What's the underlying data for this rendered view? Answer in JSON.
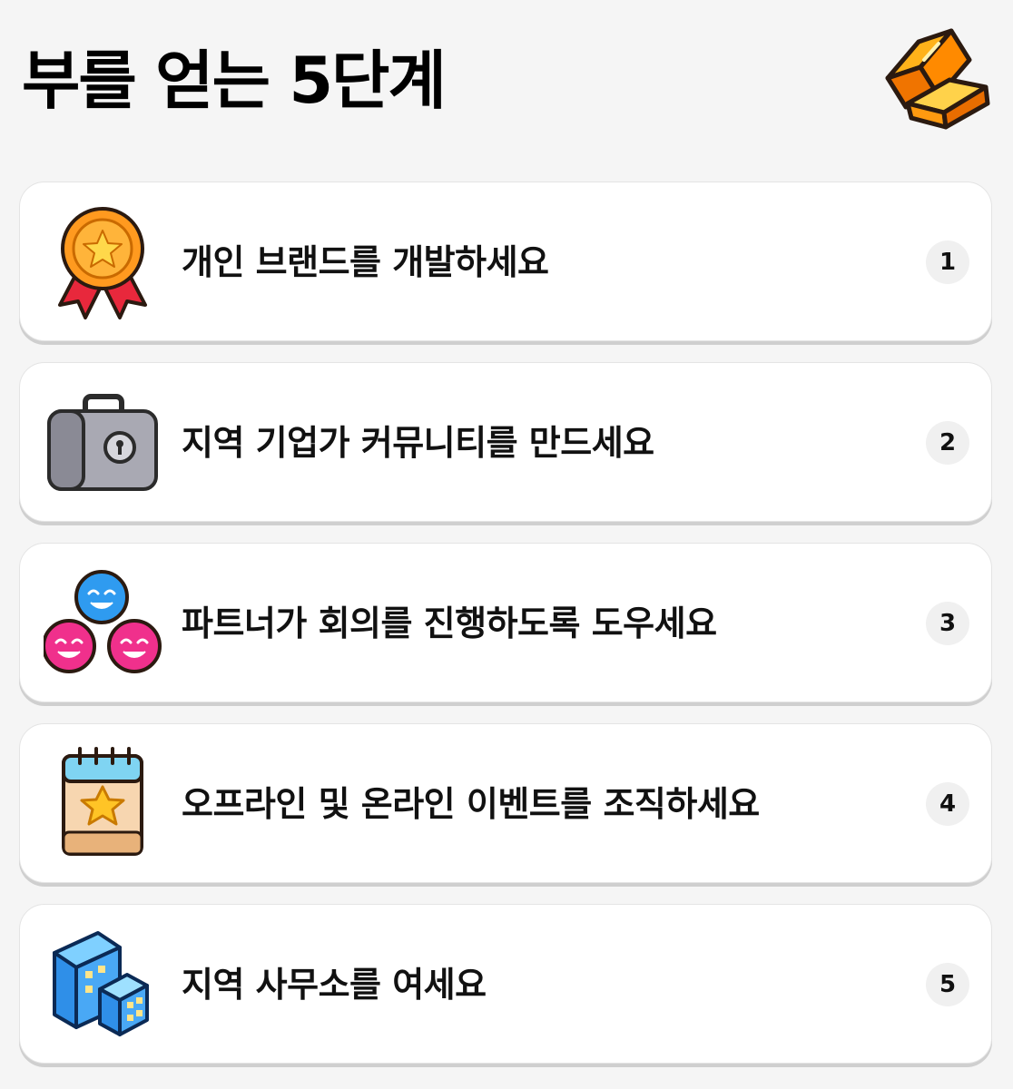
{
  "header": {
    "title": "부를 얻는 5단계",
    "icon": "gold-bars-icon"
  },
  "steps": [
    {
      "number": "1",
      "label": "개인 브랜드를 개발하세요",
      "icon": "medal-icon"
    },
    {
      "number": "2",
      "label": "지역 기업가 커뮤니티를 만드세요",
      "icon": "briefcase-icon"
    },
    {
      "number": "3",
      "label": "파트너가 회의를 진행하도록 도우세요",
      "icon": "people-group-icon"
    },
    {
      "number": "4",
      "label": "오프라인 및 온라인 이벤트를 조직하세요",
      "icon": "calendar-icon"
    },
    {
      "number": "5",
      "label": "지역 사무소를 여세요",
      "icon": "office-building-icon"
    }
  ],
  "colors": {
    "background": "#f5f5f5",
    "card": "#ffffff",
    "badge": "#f0f0f0"
  }
}
